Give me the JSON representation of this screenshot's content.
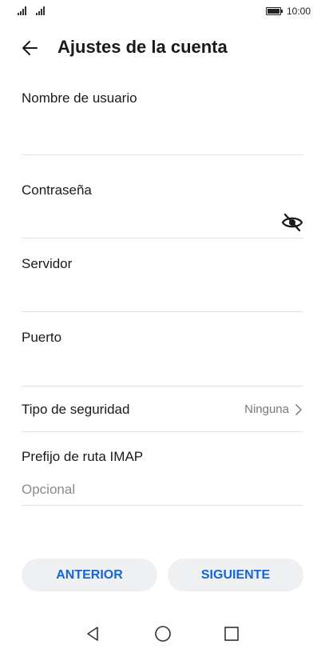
{
  "status_bar": {
    "time": "10:00",
    "battery_level": 1.0
  },
  "header": {
    "title": "Ajustes de la cuenta"
  },
  "form": {
    "username_label": "Nombre de usuario",
    "password_label": "Contraseña",
    "server_label": "Servidor",
    "port_label": "Puerto",
    "security_label": "Tipo de seguridad",
    "security_value": "Ninguna",
    "imap_prefix_label": "Prefijo de ruta IMAP",
    "imap_prefix_placeholder": "Opcional"
  },
  "buttons": {
    "previous": "ANTERIOR",
    "next": "SIGUIENTE"
  },
  "colors": {
    "accent": "#1565d8",
    "button_bg": "#eef0f2",
    "divider": "#e3e3e3",
    "placeholder": "#8a8a8a"
  },
  "icons": [
    "signal-icon",
    "battery-icon",
    "back-arrow-icon",
    "eye-hidden-icon",
    "chevron-right-icon",
    "nav-back-icon",
    "nav-home-icon",
    "nav-recent-icon"
  ]
}
